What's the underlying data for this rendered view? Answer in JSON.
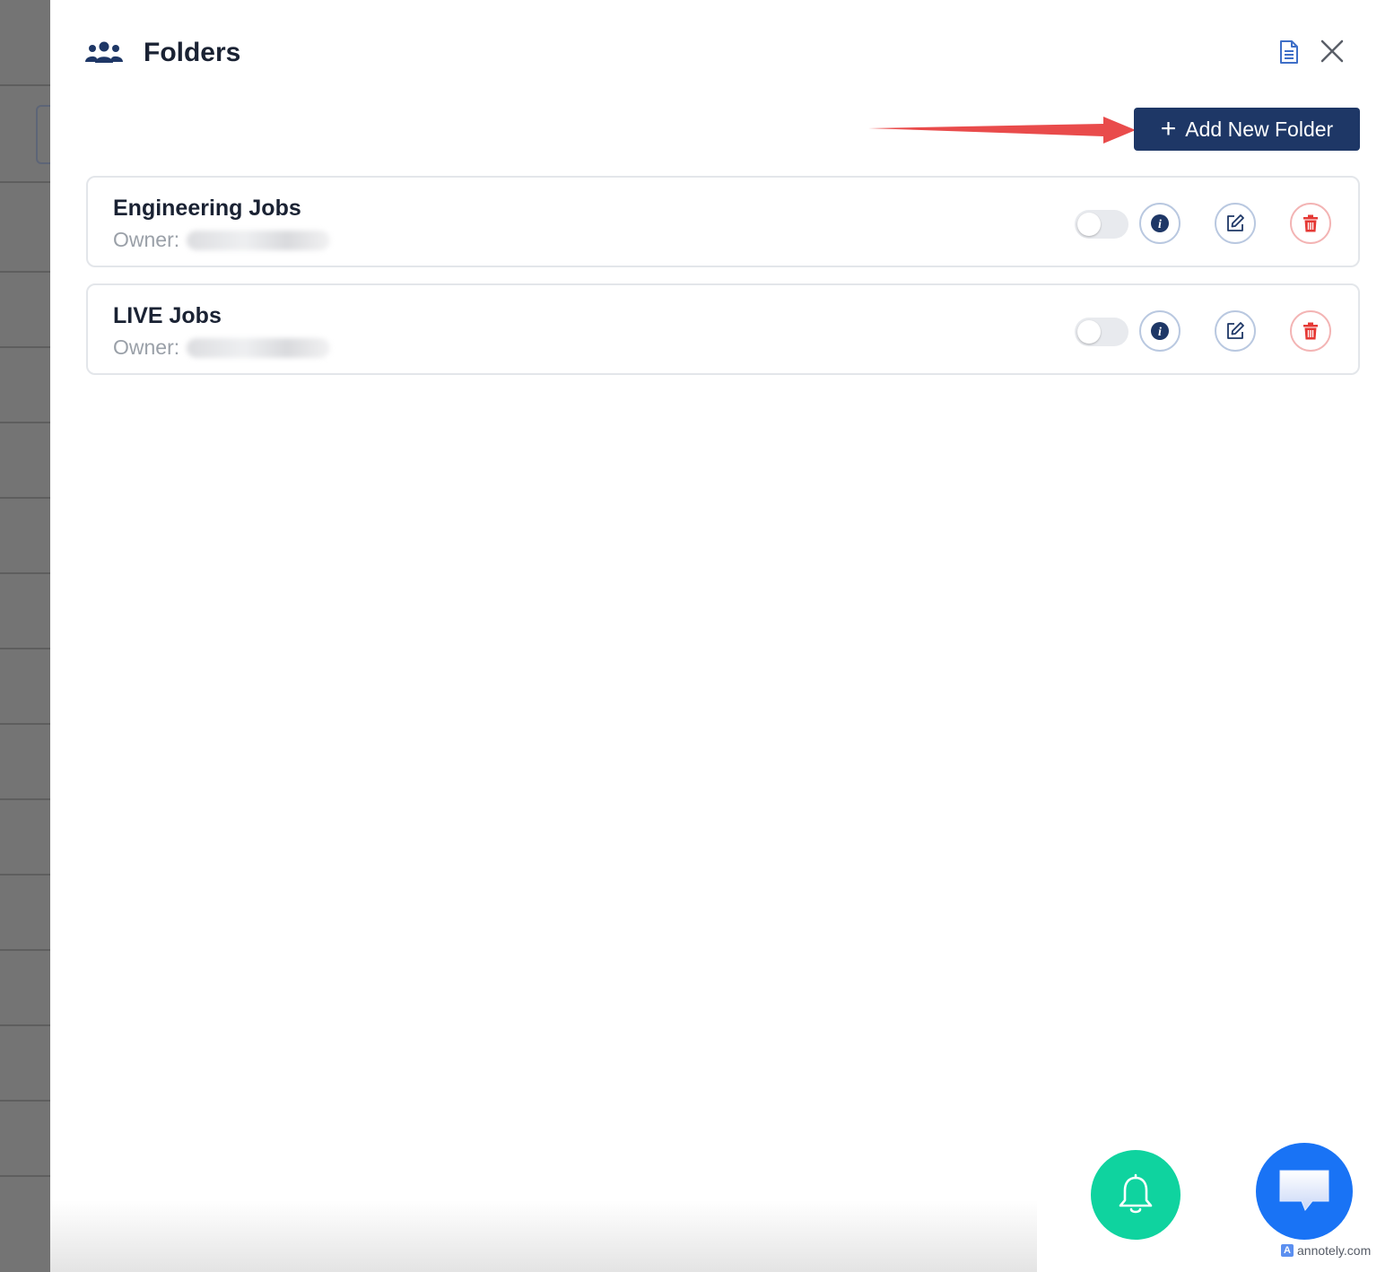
{
  "header": {
    "title": "Folders",
    "icons": {
      "team": "users-group-icon",
      "document": "document-icon",
      "close": "close-icon"
    }
  },
  "actions": {
    "add_folder_label": "Add New Folder"
  },
  "folders": [
    {
      "name": "Engineering Jobs",
      "owner_label": "Owner:",
      "owner_value": "",
      "enabled": false
    },
    {
      "name": "LIVE Jobs",
      "owner_label": "Owner:",
      "owner_value": "",
      "enabled": false
    }
  ],
  "colors": {
    "primary": "#1e3766",
    "danger": "#e53935",
    "bell_fab": "#0fd39f",
    "chat_fab": "#1973f5",
    "annotation_arrow": "#e94b4b"
  },
  "watermark": {
    "text": "annotely.com"
  }
}
